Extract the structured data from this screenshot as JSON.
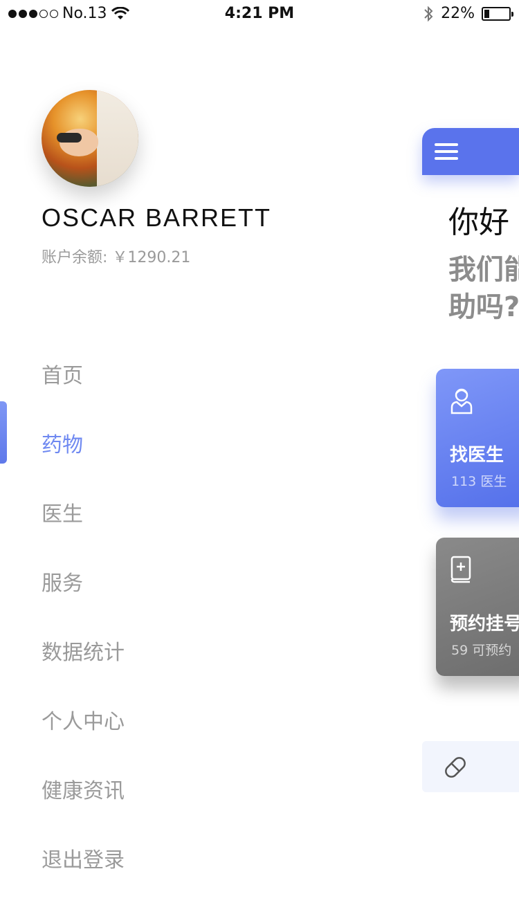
{
  "status_bar": {
    "carrier": "No.13",
    "time": "4:21 PM",
    "battery_percent": "22%",
    "battery_level": 0.22,
    "signal_dots_filled": 3,
    "icons": [
      "wifi-icon",
      "bluetooth-icon",
      "battery-icon"
    ]
  },
  "profile": {
    "name": "OSCAR BARRETT",
    "balance_label": "账户余额:",
    "balance_value": "￥1290.21"
  },
  "menu": {
    "active_index": 1,
    "items": [
      {
        "label": "首页"
      },
      {
        "label": "药物"
      },
      {
        "label": "医生"
      },
      {
        "label": "服务"
      },
      {
        "label": "数据统计"
      },
      {
        "label": "个人中心"
      },
      {
        "label": "健康资讯"
      },
      {
        "label": "退出登录"
      }
    ]
  },
  "main_peek": {
    "greeting": "你好",
    "help_line1": "我们能",
    "help_line2": "助吗?",
    "cards": [
      {
        "title": "找医生",
        "count": "113",
        "unit": "医生",
        "icon": "doctor-icon"
      },
      {
        "title": "预约挂号",
        "count": "59",
        "unit": "可预约",
        "icon": "medical-book-icon"
      }
    ],
    "bottom_icon": "pill-icon"
  },
  "colors": {
    "accent": "#5a73ec",
    "menu_active": "#6f89f1",
    "menu_inactive": "#9a9a9a"
  }
}
